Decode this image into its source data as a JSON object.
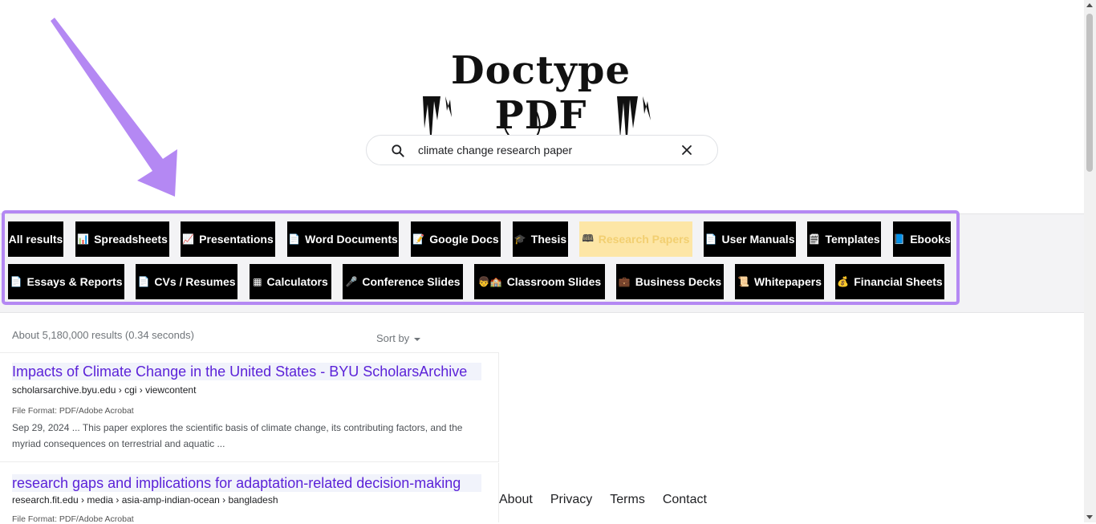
{
  "logo": {
    "text": "Doctype PDF"
  },
  "search": {
    "value": "climate change research paper",
    "placeholder": ""
  },
  "categories": {
    "row1": [
      {
        "emoji": "",
        "label": "All results"
      },
      {
        "emoji": "📊",
        "label": "Spreadsheets"
      },
      {
        "emoji": "📈",
        "label": "Presentations"
      },
      {
        "emoji": "📄",
        "label": "Word Documents"
      },
      {
        "emoji": "📝",
        "label": "Google Docs"
      },
      {
        "emoji": "🎓",
        "label": "Thesis"
      },
      {
        "emoji": "🕮",
        "label": "Research Papers",
        "active": true
      },
      {
        "emoji": "📄",
        "label": "User Manuals"
      },
      {
        "emoji": "🗒",
        "label": "Templates"
      },
      {
        "emoji": "📘",
        "label": "Ebooks"
      }
    ],
    "row2": [
      {
        "emoji": "📄",
        "label": "Essays & Reports"
      },
      {
        "emoji": "📄",
        "label": "CVs / Resumes"
      },
      {
        "emoji": "▦",
        "label": "Calculators"
      },
      {
        "emoji": "🎤",
        "label": "Conference Slides"
      },
      {
        "emoji": "👦🏫",
        "label": "Classroom Slides"
      },
      {
        "emoji": "💼",
        "label": "Business Decks"
      },
      {
        "emoji": "📜",
        "label": "Whitepapers"
      },
      {
        "emoji": "💰",
        "label": "Financial Sheets"
      }
    ]
  },
  "results_meta": {
    "stats": "About 5,180,000 results (0.34 seconds)",
    "sort_label": "Sort by"
  },
  "results": [
    {
      "title": "Impacts of Climate Change in the United States - BYU ScholarsArchive",
      "url": "scholarsarchive.byu.edu › cgi › viewcontent",
      "format": "File Format: PDF/Adobe Acrobat",
      "snippet": "Sep 29, 2024 ... This paper explores the scientific basis of climate change, its contributing factors, and the myriad consequences on terrestrial and aquatic ..."
    },
    {
      "title": "research gaps and implications for adaptation-related decision-making",
      "url": "research.fit.edu › media › asia-amp-indian-ocean › bangladesh",
      "format": "File Format: PDF/Adobe Acrobat",
      "snippet": ""
    }
  ],
  "footer": {
    "about": "About",
    "privacy": "Privacy",
    "terms": "Terms",
    "contact": "Contact"
  },
  "colors": {
    "highlight": "#b488f3",
    "link": "#5b22d8",
    "active_chip_bg": "#fde6a6",
    "active_chip_text": "#f2cf71"
  }
}
